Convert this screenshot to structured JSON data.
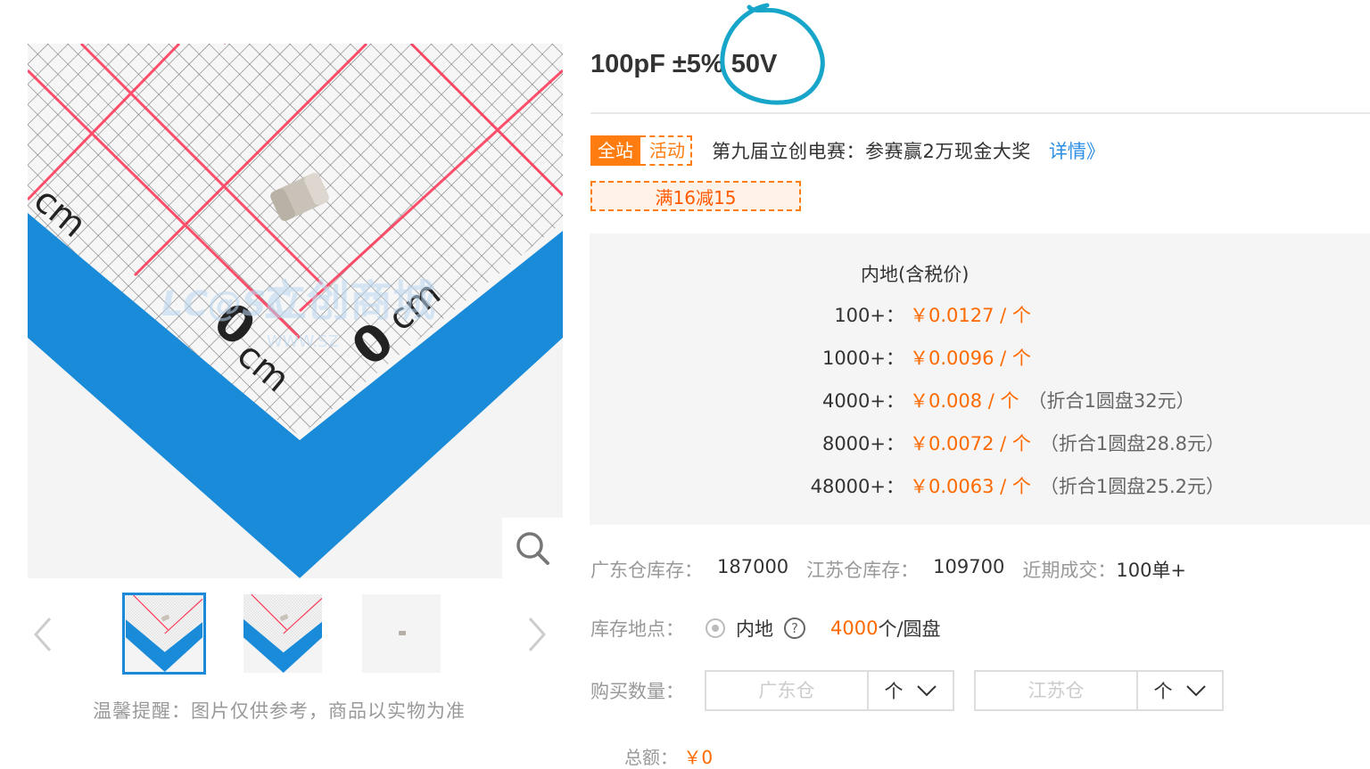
{
  "gallery": {
    "watermark_latin": "LC@SC",
    "watermark_cn": "立创商城",
    "watermark_url": "WWW.SZ",
    "ruler_labels": [
      "cm",
      "0",
      "cm",
      "0",
      "cm"
    ],
    "tip": "温馨提醒：图片仅供参考，商品以实物为准",
    "thumbnails": 3,
    "active_thumbnail": 1
  },
  "product": {
    "title": "100pF ±5% 50V"
  },
  "promo": {
    "tag_site": "全站",
    "tag_event": "活动",
    "text": "第九届立创电赛：参赛赢2万现金大奖",
    "link": "详情》",
    "coupon": "满16减15"
  },
  "pricing": {
    "header": "内地(含税价)",
    "tiers": [
      {
        "qty": "100+：",
        "price": "￥0.0127 / 个",
        "note": ""
      },
      {
        "qty": "1000+：",
        "price": "￥0.0096 / 个",
        "note": ""
      },
      {
        "qty": "4000+：",
        "price": "￥0.008 / 个",
        "note": "（折合1圆盘32元）"
      },
      {
        "qty": "8000+：",
        "price": "￥0.0072 / 个",
        "note": "（折合1圆盘28.8元）"
      },
      {
        "qty": "48000+：",
        "price": "￥0.0063 / 个",
        "note": "（折合1圆盘25.2元）"
      }
    ]
  },
  "stock": {
    "gd_label": "广东仓库存：",
    "gd_value": "187000",
    "js_label": "江苏仓库存：",
    "js_value": "109700",
    "recent_label": "近期成交：",
    "recent_value": "100单+"
  },
  "location": {
    "label": "库存地点：",
    "option": "内地",
    "help": "?",
    "pack_num": "4000",
    "pack_unit": "个/圆盘"
  },
  "quantity": {
    "label": "购买数量：",
    "gd_placeholder": "广东仓",
    "js_placeholder": "江苏仓",
    "unit": "个"
  },
  "cut": {
    "label": "总额：",
    "value": "￥0"
  },
  "colors": {
    "accent_orange": "#ff6a00",
    "link_blue": "#2d8ee5",
    "annotation_cyan": "#17a6c9"
  }
}
